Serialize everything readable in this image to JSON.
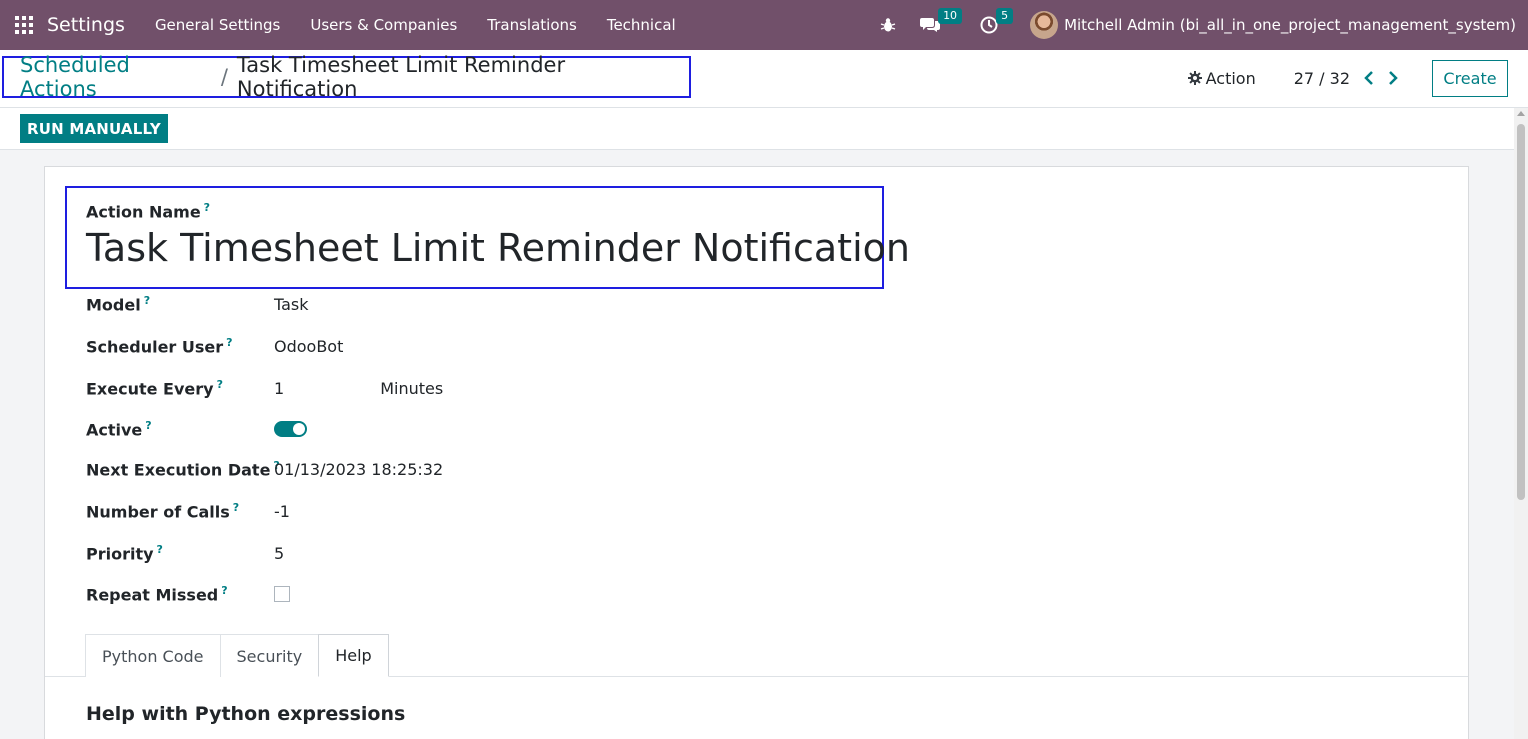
{
  "navbar": {
    "brand": "Settings",
    "menu": [
      "General Settings",
      "Users & Companies",
      "Translations",
      "Technical"
    ],
    "icons": {
      "apps": "apps-grid-icon",
      "debug": "bug-icon",
      "messages": "chat-icon",
      "activities": "clock-icon"
    },
    "messages_count": "10",
    "activities_count": "5",
    "user_name": "Mitchell Admin (bi_all_in_one_project_management_system)"
  },
  "control_panel": {
    "breadcrumb_parent": "Scheduled Actions",
    "breadcrumb_separator": "/",
    "breadcrumb_current": "Task Timesheet Limit Reminder Notification",
    "action_label": "Action",
    "pager": "27 / 32",
    "create_label": "Create"
  },
  "statusbar": {
    "run_label": "RUN MANUALLY"
  },
  "form": {
    "help_mark": "?",
    "title_label": "Action Name",
    "title_value": "Task Timesheet Limit Reminder Notification",
    "fields": [
      {
        "label": "Model",
        "value": "Task"
      },
      {
        "label": "Scheduler User",
        "value": "OdooBot"
      },
      {
        "label": "Execute Every",
        "value": "1",
        "unit": "Minutes"
      },
      {
        "label": "Active",
        "value": true
      },
      {
        "label": "Next Execution Date",
        "value": "01/13/2023 18:25:32"
      },
      {
        "label": "Number of Calls",
        "value": "-1"
      },
      {
        "label": "Priority",
        "value": "5"
      },
      {
        "label": "Repeat Missed",
        "value": false
      }
    ],
    "tabs": [
      "Python Code",
      "Security",
      "Help"
    ],
    "active_tab": "Help",
    "help_heading": "Help with Python expressions"
  },
  "colors": {
    "navbar": "#71506a",
    "accent": "#017e84",
    "highlight_box": "#1e1ee0"
  }
}
